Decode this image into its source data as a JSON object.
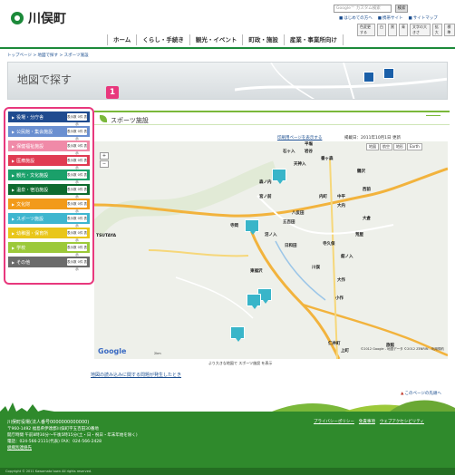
{
  "header": {
    "logo_text": "川俣町",
    "search_placeholder": "Google™ カスタム検索",
    "search_button": "検索",
    "top_links": [
      "はじめての方へ",
      "携帯サイト",
      "サイトマップ"
    ],
    "text_tools": [
      "色変更する",
      "白",
      "黒",
      "青",
      "文字の大きさ",
      "拡大",
      "標準"
    ]
  },
  "nav": [
    "ホーム",
    "くらし・手続き",
    "観光・イベント",
    "町政・施設",
    "産業・事業所向け"
  ],
  "breadcrumb": "トップページ > 地図で探す > スポーツ施設",
  "banner": {
    "title": "地図で探す"
  },
  "sidebar": {
    "badge": "1",
    "categories": [
      {
        "label": "役場・分庁舎",
        "color": "#1f4b8f"
      },
      {
        "label": "公民館・集会施設",
        "color": "#6a8fd0"
      },
      {
        "label": "保健福祉施設",
        "color": "#f08aa8"
      },
      {
        "label": "医療施設",
        "color": "#e03b52"
      },
      {
        "label": "観光・文化施設",
        "color": "#1aa06a"
      },
      {
        "label": "温泉・宿泊施設",
        "color": "#0f6b2f"
      },
      {
        "label": "文化財",
        "color": "#f29a1a"
      },
      {
        "label": "スポーツ施設",
        "color": "#3fb6cf"
      },
      {
        "label": "幼稚園・保育所",
        "color": "#e9c61a"
      },
      {
        "label": "学校",
        "color": "#9cc93a"
      },
      {
        "label": "その他",
        "color": "#6b6b6b"
      }
    ],
    "count_label": "表示数 0件 表示"
  },
  "content": {
    "title": "スポーツ施設",
    "print_link": "印刷用ページを表示する",
    "date_text": "掲載日：2011年10月1日 更新",
    "map_types": [
      "地図",
      "航空",
      "地形",
      "Earth"
    ],
    "zoom": [
      "+",
      "−"
    ],
    "google": "Google",
    "map_copyright": "©2012 Google -\n地図データ ©2012 ZENRIN - 利用規約",
    "scale_text": "2km",
    "labels": [
      "石ヶ入",
      "岩谷",
      "平塩",
      "番ヶ森",
      "天神入",
      "森ノ内",
      "宮ノ前",
      "八反田",
      "五百田",
      "日和田",
      "沼ノ入",
      "寺久保",
      "東福沢",
      "内町",
      "鶴沢",
      "中平",
      "大内",
      "西前",
      "大倉",
      "大作",
      "小作",
      "上町",
      "仁井町",
      "舘ノ入",
      "川俣",
      "荒屋",
      "寺岡",
      "TSUTAYA",
      "旅館"
    ],
    "map_footer": "より大きな地図で スポーツ施設 を表示",
    "map_footer_link": "スポーツ施設",
    "notice": "地図の読み込みに関する問題が発生したとき",
    "page_top": "このページの先頭へ"
  },
  "footer": {
    "name": "川俣町役場(法人番号0000000000000)",
    "address_lines": [
      "〒960-1492 福島県伊達郡川俣町字五百田30番地",
      "開庁時間 午前8時30分～午後5時15分(土・日・祝日・年末年始を除く)",
      "電話：024-566-2111(代表) FAX：024-566-2428",
      "組織別連絡先"
    ],
    "links": [
      "プライバシーポリシー",
      "免責事項",
      "ウェブアクセシビリティ"
    ],
    "copyright": "Copyright © 2011 Kawamata town All rights reserved."
  }
}
